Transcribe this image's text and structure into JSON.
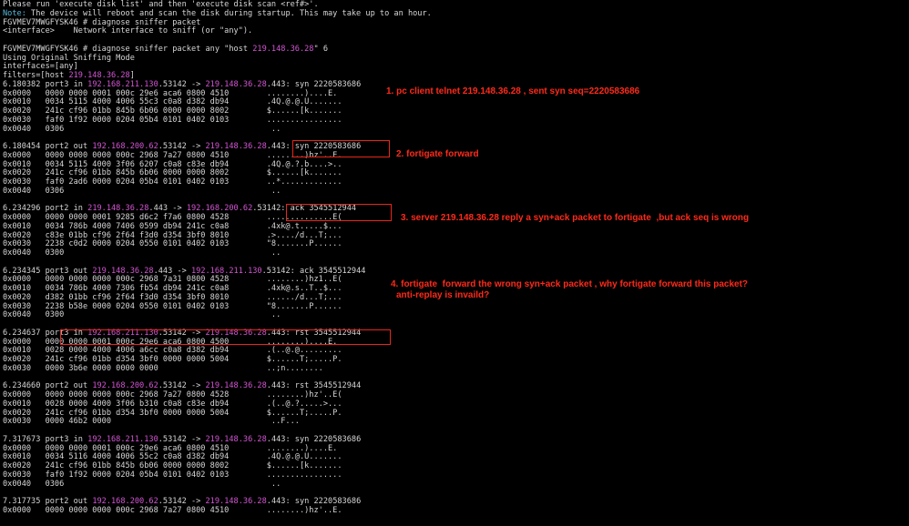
{
  "terminal": {
    "lines": [
      {
        "parts": [
          {
            "t": "Please run 'execute disk list' and then 'execute disk scan <ref#>'."
          }
        ]
      },
      {
        "parts": [
          {
            "t": "Note:",
            "c": "cyan"
          },
          {
            "t": " The device will reboot and scan the disk during startup. This may take up to an hour."
          }
        ]
      },
      {
        "parts": [
          {
            "t": "FGVMEV7MWGFYSK46 # diagnose sniffer packet"
          }
        ]
      },
      {
        "parts": [
          {
            "t": "<interface>    Network interface to sniff (or \"any\")."
          }
        ]
      },
      {
        "parts": [
          {
            "t": ""
          }
        ]
      },
      {
        "parts": [
          {
            "t": "FGVMEV7MWGFYSK46 # diagnose sniffer packet any \"host "
          },
          {
            "t": "219.148.36.28",
            "c": "mag"
          },
          {
            "t": "\" 6"
          }
        ]
      },
      {
        "parts": [
          {
            "t": "Using Original Sniffing Mode"
          }
        ]
      },
      {
        "parts": [
          {
            "t": "interfaces=[any]"
          }
        ]
      },
      {
        "parts": [
          {
            "t": "filters=[host "
          },
          {
            "t": "219.148.36.28",
            "c": "mag"
          },
          {
            "t": "]"
          }
        ]
      },
      {
        "parts": [
          {
            "t": "6.180382 port3 in "
          },
          {
            "t": "192.168.211.130",
            "c": "mag"
          },
          {
            "t": ".53142 -> "
          },
          {
            "t": "219.148.36.28",
            "c": "mag"
          },
          {
            "t": ".443: syn 2220583686"
          }
        ]
      },
      {
        "parts": [
          {
            "t": "0x0000   0000 0000 0001 000c 29e6 aca6 0800 4510        ........)....E."
          }
        ]
      },
      {
        "parts": [
          {
            "t": "0x0010   0034 5115 4000 4006 55c3 c0a8 d382 db94        .4Q.@.@.U......."
          }
        ]
      },
      {
        "parts": [
          {
            "t": "0x0020   241c cf96 01bb 845b 6b06 0000 0000 8002        $......[k......."
          }
        ]
      },
      {
        "parts": [
          {
            "t": "0x0030   faf0 1f92 0000 0204 05b4 0101 0402 0103        ................"
          }
        ]
      },
      {
        "parts": [
          {
            "t": "0x0040   0306                                            .."
          }
        ]
      },
      {
        "parts": [
          {
            "t": ""
          }
        ]
      },
      {
        "parts": [
          {
            "t": "6.180454 port2 out "
          },
          {
            "t": "192.168.200.62",
            "c": "mag"
          },
          {
            "t": ".53142 -> "
          },
          {
            "t": "219.148.36.28",
            "c": "mag"
          },
          {
            "t": ".443: syn 2220583686"
          }
        ]
      },
      {
        "parts": [
          {
            "t": "0x0000   0000 0000 0000 000c 2968 7a27 0800 4510        ........)hz'..E."
          }
        ]
      },
      {
        "parts": [
          {
            "t": "0x0010   0034 5115 4000 3f06 6207 c0a8 c83e db94        .4Q.@.?.b....>.."
          }
        ]
      },
      {
        "parts": [
          {
            "t": "0x0020   241c cf96 01bb 845b 6b06 0000 0000 8002        $......[k......."
          }
        ]
      },
      {
        "parts": [
          {
            "t": "0x0030   faf0 2ad6 0000 0204 05b4 0101 0402 0103        ..*............."
          }
        ]
      },
      {
        "parts": [
          {
            "t": "0x0040   0306                                            .."
          }
        ]
      },
      {
        "parts": [
          {
            "t": ""
          }
        ]
      },
      {
        "parts": [
          {
            "t": "6.234296 port2 in "
          },
          {
            "t": "219.148.36.28",
            "c": "mag"
          },
          {
            "t": ".443 -> "
          },
          {
            "t": "192.168.200.62",
            "c": "mag"
          },
          {
            "t": ".53142: ack 3545512944"
          }
        ]
      },
      {
        "parts": [
          {
            "t": "0x0000   0000 0000 0001 9285 d6c2 f7a6 0800 4528        ..............E("
          }
        ]
      },
      {
        "parts": [
          {
            "t": "0x0010   0034 786b 4000 7406 0599 db94 241c c0a8        .4xk@.t.....$..."
          }
        ]
      },
      {
        "parts": [
          {
            "t": "0x0020   c83e 01bb cf96 2f64 f3d0 d354 3bf0 8010        .>..../d...T;..."
          }
        ]
      },
      {
        "parts": [
          {
            "t": "0x0030   2238 c0d2 0000 0204 0550 0101 0402 0103        \"8.......P......"
          }
        ]
      },
      {
        "parts": [
          {
            "t": "0x0040   0300                                            .."
          }
        ]
      },
      {
        "parts": [
          {
            "t": ""
          }
        ]
      },
      {
        "parts": [
          {
            "t": "6.234345 port3 out "
          },
          {
            "t": "219.148.36.28",
            "c": "mag"
          },
          {
            "t": ".443 -> "
          },
          {
            "t": "192.168.211.130",
            "c": "mag"
          },
          {
            "t": ".53142: ack 3545512944"
          }
        ]
      },
      {
        "parts": [
          {
            "t": "0x0000   0000 0000 0000 000c 2968 7a31 0800 4528        ........)hz1..E("
          }
        ]
      },
      {
        "parts": [
          {
            "t": "0x0010   0034 786b 4000 7306 fb54 db94 241c c0a8        .4xk@.s..T..$..."
          }
        ]
      },
      {
        "parts": [
          {
            "t": "0x0020   d382 01bb cf96 2f64 f3d0 d354 3bf0 8010        ....../d...T;..."
          }
        ]
      },
      {
        "parts": [
          {
            "t": "0x0030   2238 b58e 0000 0204 0550 0101 0402 0103        \"8.......P......"
          }
        ]
      },
      {
        "parts": [
          {
            "t": "0x0040   0300                                            .."
          }
        ]
      },
      {
        "parts": [
          {
            "t": ""
          }
        ]
      },
      {
        "parts": [
          {
            "t": "6.234637 port3 in "
          },
          {
            "t": "192.168.211.130",
            "c": "mag"
          },
          {
            "t": ".53142 -> "
          },
          {
            "t": "219.148.36.28",
            "c": "mag"
          },
          {
            "t": ".443: rst 3545512944"
          }
        ]
      },
      {
        "parts": [
          {
            "t": "0x0000   0000 0000 0001 000c 29e6 aca6 0800 4500        ........)....E."
          }
        ]
      },
      {
        "parts": [
          {
            "t": "0x0010   0028 0000 4000 4006 a6cc c0a8 d382 db94        .(..@.@........."
          }
        ]
      },
      {
        "parts": [
          {
            "t": "0x0020   241c cf96 01bb d354 3bf0 0000 0000 5004        $......T;.....P."
          }
        ]
      },
      {
        "parts": [
          {
            "t": "0x0030   0000 3b6e 0000 0000 0000                       ..;n........"
          }
        ]
      },
      {
        "parts": [
          {
            "t": ""
          }
        ]
      },
      {
        "parts": [
          {
            "t": "6.234660 port2 out "
          },
          {
            "t": "192.168.200.62",
            "c": "mag"
          },
          {
            "t": ".53142 -> "
          },
          {
            "t": "219.148.36.28",
            "c": "mag"
          },
          {
            "t": ".443: rst 3545512944"
          }
        ]
      },
      {
        "parts": [
          {
            "t": "0x0000   0000 0000 0000 000c 2968 7a27 0800 4528        ........)hz'..E("
          }
        ]
      },
      {
        "parts": [
          {
            "t": "0x0010   0028 0000 4000 3f06 b310 c0a8 c83e db94        .(..@.?.....>..."
          }
        ]
      },
      {
        "parts": [
          {
            "t": "0x0020   241c cf96 01bb d354 3bf0 0000 0000 5004        $......T;.....P."
          }
        ]
      },
      {
        "parts": [
          {
            "t": "0x0030   0000 46b2 0000                                  ..F..."
          }
        ]
      },
      {
        "parts": [
          {
            "t": ""
          }
        ]
      },
      {
        "parts": [
          {
            "t": "7.317673 port3 in "
          },
          {
            "t": "192.168.211.130",
            "c": "mag"
          },
          {
            "t": ".53142 -> "
          },
          {
            "t": "219.148.36.28",
            "c": "mag"
          },
          {
            "t": ".443: syn 2220583686"
          }
        ]
      },
      {
        "parts": [
          {
            "t": "0x0000   0000 0000 0001 000c 29e6 aca6 0800 4510        ........)....E."
          }
        ]
      },
      {
        "parts": [
          {
            "t": "0x0010   0034 5116 4000 4006 55c2 c0a8 d382 db94        .4Q.@.@.U......."
          }
        ]
      },
      {
        "parts": [
          {
            "t": "0x0020   241c cf96 01bb 845b 6b06 0000 0000 8002        $......[k......."
          }
        ]
      },
      {
        "parts": [
          {
            "t": "0x0030   faf0 1f92 0000 0204 05b4 0101 0402 0103        ................"
          }
        ]
      },
      {
        "parts": [
          {
            "t": "0x0040   0306                                            .."
          }
        ]
      },
      {
        "parts": [
          {
            "t": ""
          }
        ]
      },
      {
        "parts": [
          {
            "t": "7.317735 port2 out "
          },
          {
            "t": "192.168.200.62",
            "c": "mag"
          },
          {
            "t": ".53142 -> "
          },
          {
            "t": "219.148.36.28",
            "c": "mag"
          },
          {
            "t": ".443: syn 2220583686"
          }
        ]
      },
      {
        "parts": [
          {
            "t": "0x0000   0000 0000 0000 000c 2968 7a27 0800 4510        ........)hz'..E."
          }
        ]
      }
    ]
  },
  "annotations": {
    "note1": "1. pc client telnet 219.148.36.28 , sent syn seq=2220583686",
    "note2": "2. fortigate forward",
    "note3": "3. server 219.148.36.28 reply a syn+ack packet to fortigate  ,but ack seq is wrong",
    "note4_line1": "4. fortigate  forward the wrong syn+ack packet , why fortigate forward this packet?",
    "note4_line2": "anti-replay is invaild?"
  },
  "colors": {
    "background": "#000000",
    "text": "#d6d6d6",
    "ip_highlight": "#d355d3",
    "note_label": "#58b8d8",
    "annotation": "#ff2a1a"
  }
}
